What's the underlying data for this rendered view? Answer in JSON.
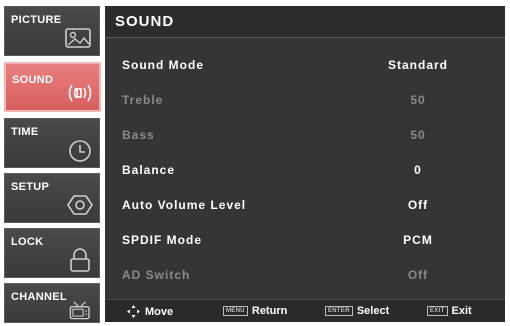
{
  "sidebar": {
    "tabs": [
      {
        "label": "PICTURE",
        "icon": "picture-icon"
      },
      {
        "label": "SOUND",
        "icon": "speaker-icon",
        "active": true
      },
      {
        "label": "TIME",
        "icon": "clock-icon"
      },
      {
        "label": "SETUP",
        "icon": "gear-icon"
      },
      {
        "label": "LOCK",
        "icon": "padlock-icon"
      },
      {
        "label": "CHANNEL",
        "icon": "tv-icon"
      }
    ]
  },
  "main": {
    "title": "SOUND",
    "rows": [
      {
        "label": "Sound Mode",
        "value": "Standard",
        "enabled": true
      },
      {
        "label": "Treble",
        "value": "50",
        "enabled": false
      },
      {
        "label": "Bass",
        "value": "50",
        "enabled": false
      },
      {
        "label": "Balance",
        "value": "0",
        "enabled": true
      },
      {
        "label": "Auto Volume Level",
        "value": "Off",
        "enabled": true
      },
      {
        "label": "SPDIF Mode",
        "value": "PCM",
        "enabled": true
      },
      {
        "label": "AD Switch",
        "value": "Off",
        "enabled": false
      }
    ]
  },
  "footer": {
    "move": "Move",
    "return_key": "MENU",
    "return_label": "Return",
    "select_key": "ENTER",
    "select_label": "Select",
    "exit_key": "EXIT",
    "exit_label": "Exit"
  },
  "colors": {
    "active_tab": "#d85f60",
    "panel": "#353535",
    "disabled_text": "#8a8a8a"
  }
}
